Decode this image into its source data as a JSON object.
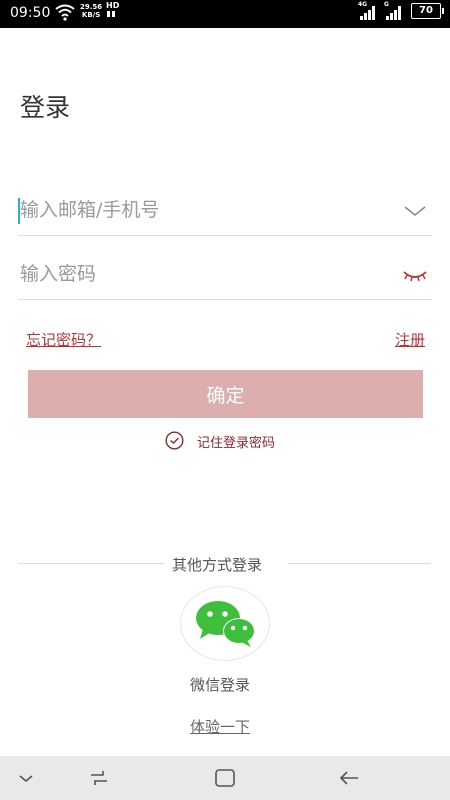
{
  "status_bar": {
    "time": "09:50",
    "speed_value": "29.56",
    "speed_unit": "KB/S",
    "hd": "HD",
    "net1": "4G",
    "net2": "G",
    "battery": "70"
  },
  "page": {
    "title": "登录"
  },
  "form": {
    "account_placeholder": "输入邮箱/手机号",
    "password_placeholder": "输入密码",
    "forgot_label": "忘记密码？",
    "register_label": "注册",
    "confirm_label": "确定",
    "remember_label": "记住登录密码"
  },
  "other_login": {
    "label": "其他方式登录",
    "wechat_label": "微信登录",
    "trial_label": "体验一下"
  },
  "colors": {
    "accent": "#b83434",
    "button_bg": "#dcaeae",
    "wechat_green": "#3dbf3d"
  },
  "icons": {
    "account_dropdown": "chevron-down-icon",
    "password_toggle": "eye-closed-icon",
    "remember": "check-circle-icon",
    "wechat": "wechat-icon"
  }
}
